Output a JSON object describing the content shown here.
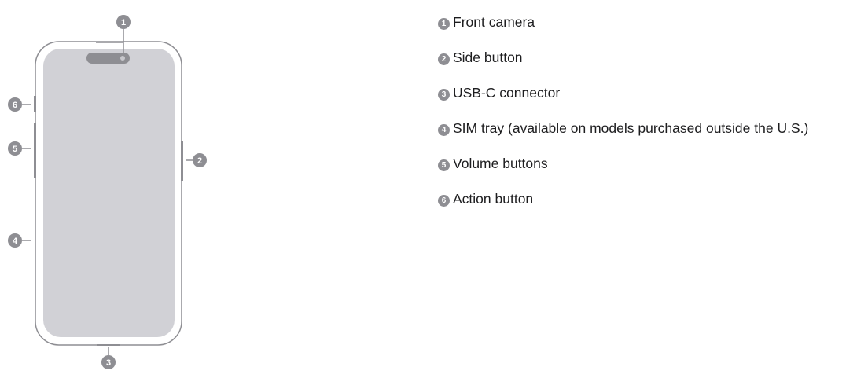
{
  "diagram": {
    "callouts": [
      {
        "number": "1",
        "label": "Front camera"
      },
      {
        "number": "2",
        "label": "Side button"
      },
      {
        "number": "3",
        "label": "USB-C connector"
      },
      {
        "number": "4",
        "label": "SIM tray (available on models purchased outside the U.S.)"
      },
      {
        "number": "5",
        "label": "Volume buttons"
      },
      {
        "number": "6",
        "label": "Action button"
      }
    ]
  }
}
